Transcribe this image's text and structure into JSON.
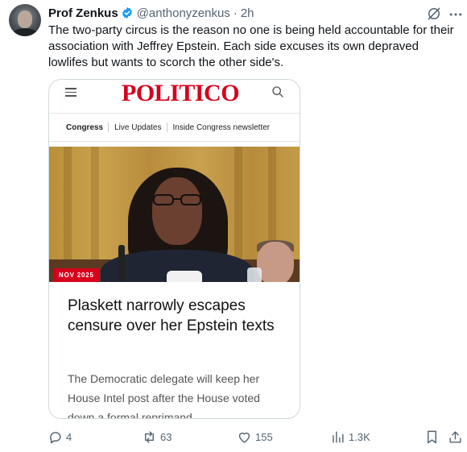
{
  "tweet": {
    "author_name": "Prof Zenkus",
    "handle": "@anthonyzenkus",
    "separator": "·",
    "time": "2h",
    "text": "The two-party circus is the reason no one is being held accountable for their association with Jeffrey Epstein. Each side excuses its own depraved lowlifes but wants to scorch the other side's.",
    "verified_icon": "verified-badge-icon",
    "accent_color": "#1d9bf0"
  },
  "card": {
    "logo": "POLITICO",
    "brand_color": "#d6001c",
    "nav": [
      "Congress",
      "Live Updates",
      "Inside Congress newsletter"
    ],
    "badge": "NOV 2025",
    "headline": "Plaskett narrowly escapes censure over her Epstein texts",
    "dek": "The Democratic delegate will keep her House Intel post after the House voted down a formal reprimand."
  },
  "actions": {
    "replies": "4",
    "reposts": "63",
    "likes": "155",
    "views": "1.3K"
  }
}
